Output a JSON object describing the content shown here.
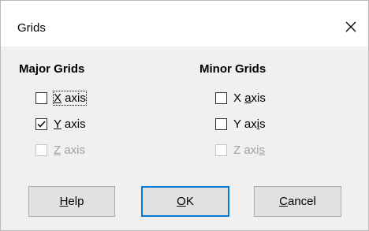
{
  "window": {
    "title": "Grids"
  },
  "major": {
    "heading": "Major Grids",
    "options": [
      {
        "pre": "",
        "key": "X",
        "post": " axis",
        "checked": false,
        "enabled": true
      },
      {
        "pre": "",
        "key": "Y",
        "post": " axis",
        "checked": true,
        "enabled": true
      },
      {
        "pre": "",
        "key": "Z",
        "post": " axis",
        "checked": false,
        "enabled": false
      }
    ]
  },
  "minor": {
    "heading": "Minor Grids",
    "options": [
      {
        "pre": "X ",
        "key": "a",
        "post": "xis",
        "checked": false,
        "enabled": true
      },
      {
        "pre": "Y ax",
        "key": "i",
        "post": "s",
        "checked": false,
        "enabled": true
      },
      {
        "pre": "Z axi",
        "key": "s",
        "post": "",
        "checked": false,
        "enabled": false
      }
    ]
  },
  "buttons": {
    "help": {
      "key": "H",
      "rest": "elp"
    },
    "ok": {
      "key": "O",
      "rest": "K"
    },
    "cancel": {
      "key": "C",
      "rest": "ancel"
    }
  },
  "colors": {
    "accent": "#0078d7",
    "disabled": "#a0a0a0",
    "dialog_bg": "#f0f0f0"
  }
}
